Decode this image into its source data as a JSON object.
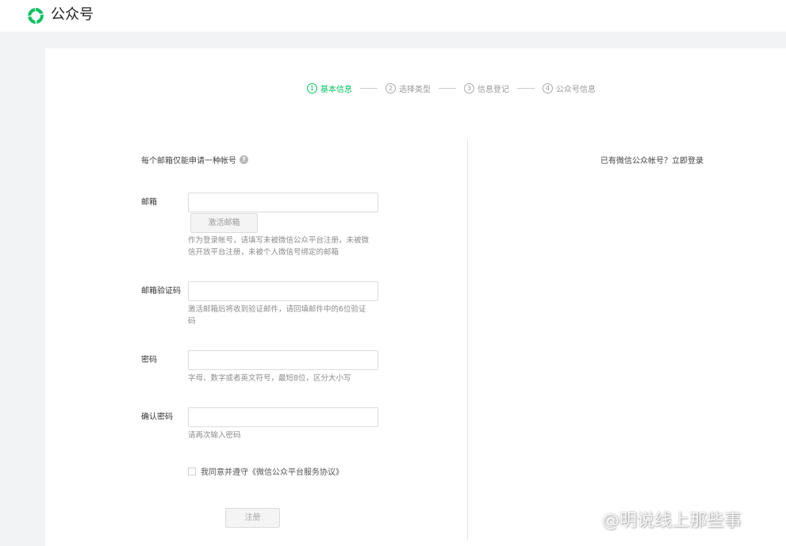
{
  "header": {
    "brand": "公众号"
  },
  "steps": [
    {
      "num": "1",
      "label": "基本信息"
    },
    {
      "num": "2",
      "label": "选择类型"
    },
    {
      "num": "3",
      "label": "信息登记"
    },
    {
      "num": "4",
      "label": "公众号信息"
    }
  ],
  "form": {
    "tip": "每个邮箱仅能申请一种帐号",
    "email": {
      "label": "邮箱",
      "value": "",
      "activate_button": "激活邮箱",
      "hint": "作为登录帐号，请填写未被微信公众平台注册，未被微信开放平台注册，未被个人微信号绑定的邮箱"
    },
    "code": {
      "label": "邮箱验证码",
      "value": "",
      "hint": "激活邮箱后将收到验证邮件，请回填邮件中的6位验证码"
    },
    "password": {
      "label": "密码",
      "value": "",
      "hint": "字母、数字或者英文符号，最短8位，区分大小写"
    },
    "confirm": {
      "label": "确认密码",
      "value": "",
      "hint": "请再次输入密码"
    },
    "agreement": "我同意并遵守《微信公众平台服务协议》",
    "register_button": "注册"
  },
  "side": {
    "prompt": "已有微信公众帐号？",
    "login_link": "立即登录"
  },
  "watermark": "@明说线上那些事",
  "colors": {
    "accent": "#07c160"
  }
}
